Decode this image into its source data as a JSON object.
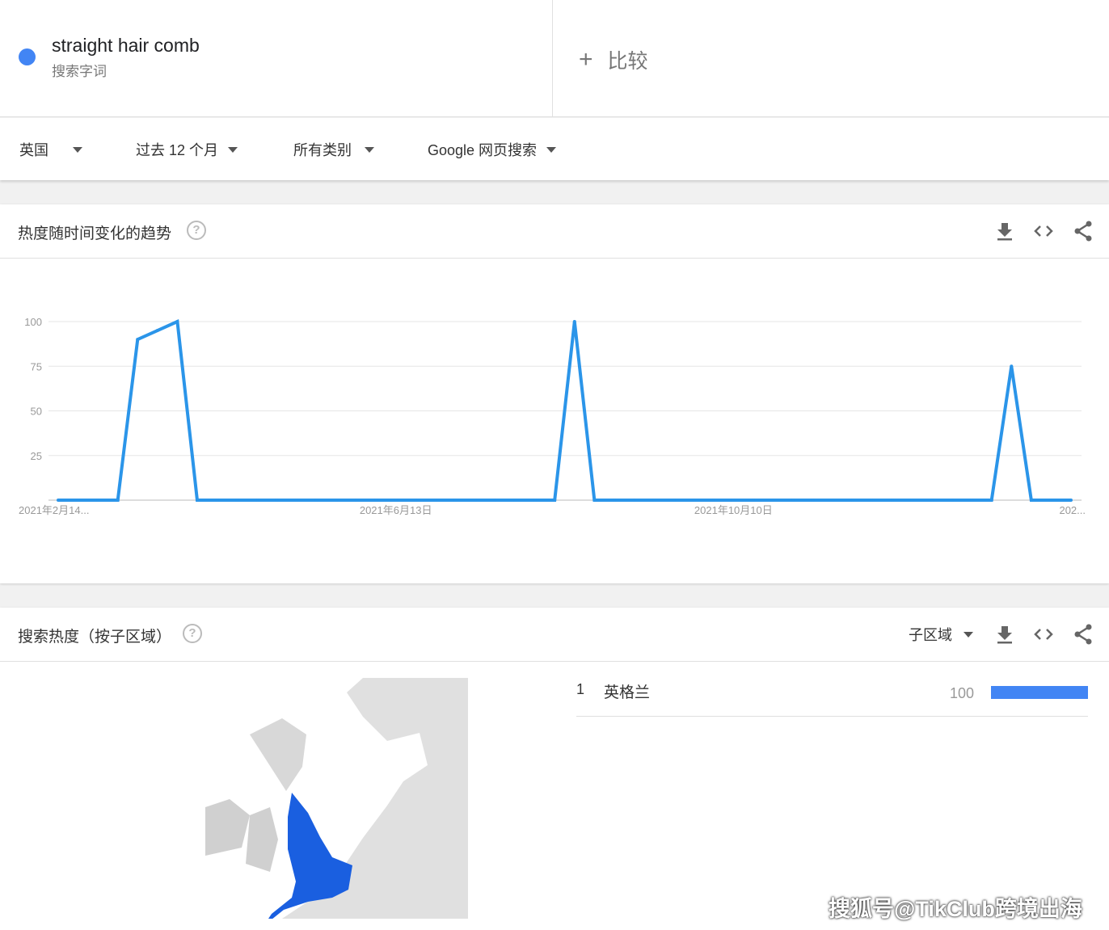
{
  "header": {
    "term": "straight hair comb",
    "term_sub": "搜索字词",
    "term_color": "#4285f4",
    "compare_label": "比较",
    "compare_icon": "plus-icon"
  },
  "filters": [
    {
      "label": "英国"
    },
    {
      "label": "过去 12 个月"
    },
    {
      "label": "所有类别"
    },
    {
      "label": "Google 网页搜索"
    }
  ],
  "trend_card": {
    "title": "热度随时间变化的趋势",
    "help": "?",
    "icons": [
      "download-icon",
      "embed-icon",
      "share-icon"
    ]
  },
  "chart_data": {
    "type": "line",
    "title": "",
    "xlabel": "",
    "ylabel": "",
    "ylim": [
      0,
      100
    ],
    "grid": true,
    "yticks": [
      "100",
      "75",
      "50",
      "25"
    ],
    "xtick_labels": [
      "2021年2月14...",
      "2021年6月13日",
      "2021年10月10日",
      "202..."
    ],
    "x_start": "2021-02-14",
    "x_interval": "weekly",
    "color": "#2b95e9",
    "values": [
      0,
      0,
      0,
      0,
      90,
      95,
      100,
      0,
      0,
      0,
      0,
      0,
      0,
      0,
      0,
      0,
      0,
      0,
      0,
      0,
      0,
      0,
      0,
      0,
      0,
      0,
      100,
      0,
      0,
      0,
      0,
      0,
      0,
      0,
      0,
      0,
      0,
      0,
      0,
      0,
      0,
      0,
      0,
      0,
      0,
      0,
      0,
      0,
      75,
      0,
      0,
      0
    ]
  },
  "region_card": {
    "title": "搜索热度（按子区域）",
    "help": "?",
    "selector": "子区域",
    "map_highlight_color": "#1a5fe0",
    "rows": [
      {
        "rank": "1",
        "name": "英格兰",
        "value": "100",
        "fraction": 1.0,
        "bar_color": "#4285f4"
      }
    ]
  },
  "watermark": "搜狐号@TikClub跨境出海"
}
